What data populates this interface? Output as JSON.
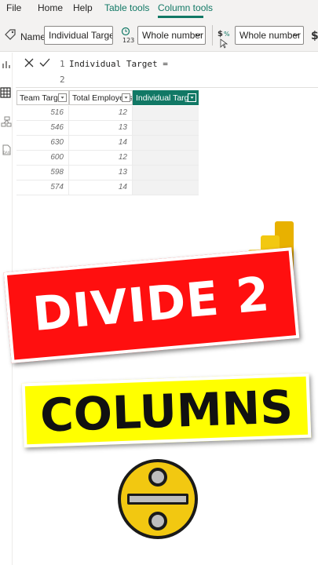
{
  "menu": {
    "items": [
      {
        "label": "File"
      },
      {
        "label": "Home"
      },
      {
        "label": "Help"
      },
      {
        "label": "Table tools"
      },
      {
        "label": "Column tools"
      }
    ]
  },
  "ribbon": {
    "name_label": "Name",
    "name_value": "Individual Target",
    "data_type_value": "Whole number",
    "format_value": "Whole number"
  },
  "formula": {
    "lines": [
      {
        "number": "1",
        "text": "Individual Target ="
      },
      {
        "number": "2",
        "text": ""
      }
    ]
  },
  "table": {
    "columns": [
      "Team Target",
      "Total Employees",
      "Individual Target"
    ],
    "rows": [
      [
        "516",
        "12",
        ""
      ],
      [
        "546",
        "13",
        ""
      ],
      [
        "630",
        "14",
        ""
      ],
      [
        "600",
        "12",
        ""
      ],
      [
        "598",
        "13",
        ""
      ],
      [
        "574",
        "14",
        ""
      ]
    ]
  },
  "thumbnail": {
    "title_line1": "DIVIDE 2",
    "title_line2": "COLUMNS",
    "colors": {
      "accent": "#117865",
      "red_banner": "#ff0f0f",
      "yellow_banner": "#ffff00",
      "logo_gold": "#f2c811"
    }
  }
}
